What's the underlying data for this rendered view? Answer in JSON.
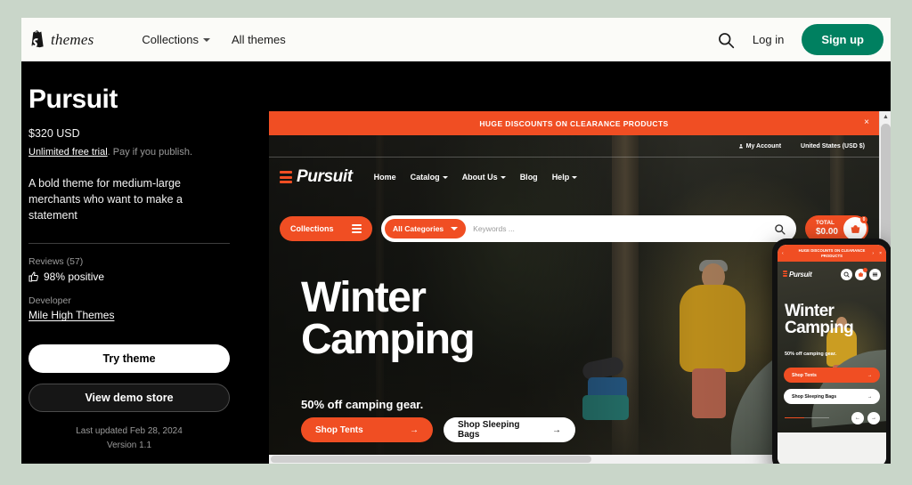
{
  "header": {
    "brand_word": "themes",
    "logo_icon": "shopify-bag-icon",
    "nav": [
      {
        "label": "Collections",
        "has_caret": true
      },
      {
        "label": "All themes",
        "has_caret": false
      }
    ],
    "search_icon": "search-icon",
    "login_label": "Log in",
    "signup_label": "Sign up",
    "signup_color": "#008060"
  },
  "theme": {
    "title": "Pursuit",
    "price": "$320 USD",
    "trial_link": "Unlimited free trial",
    "trial_rest": ". Pay if you publish.",
    "description": "A bold theme for medium-large merchants who want to make a statement",
    "reviews_label": "Reviews (57)",
    "rating_text": "98% positive",
    "rating_icon": "thumbs-up-icon",
    "developer_label": "Developer",
    "developer_name": "Mile High Themes",
    "try_label": "Try theme",
    "demo_label": "View demo store",
    "last_updated": "Last updated Feb 28, 2024",
    "version": "Version 1.1"
  },
  "preview": {
    "announcement": "HUGE DISCOUNTS ON CLEARANCE PRODUCTS",
    "announcement_close": "×",
    "utility": [
      {
        "label": "My Account",
        "icon": "user-icon"
      },
      {
        "label": "United States (USD $)",
        "icon": ""
      }
    ],
    "store_brand": "Pursuit",
    "store_nav": [
      {
        "label": "Home",
        "caret": false
      },
      {
        "label": "Catalog",
        "caret": true
      },
      {
        "label": "About Us",
        "caret": true
      },
      {
        "label": "Blog",
        "caret": false
      },
      {
        "label": "Help",
        "caret": true
      }
    ],
    "collections_pill": "Collections",
    "category_pill": "All Categories",
    "search_placeholder": "Keywords ...",
    "cart_total_label": "TOTAL",
    "cart_total_value": "$0.00",
    "cart_count": "0",
    "hero_title_line1": "Winter",
    "hero_title_line2": "Camping",
    "hero_subtitle": "50% off camping gear.",
    "cta_primary": "Shop Tents",
    "cta_secondary": "Shop Sleeping Bags",
    "cta_arrow": "→",
    "accent_color": "#f04e23"
  },
  "mobile": {
    "announcement": "HUGE DISCOUNTS ON CLEARANCE PRODUCTS",
    "prev_arrow": "‹",
    "next_arrow": "›",
    "close": "×",
    "store_brand": "Pursuit",
    "hero_title_line1": "Winter",
    "hero_title_line2": "Camping",
    "hero_subtitle": "50% off camping gear.",
    "cta_primary": "Shop Tents",
    "cta_secondary": "Shop Sleeping Bags",
    "cta_arrow": "→",
    "carousel_prev": "←",
    "carousel_next": "→"
  }
}
